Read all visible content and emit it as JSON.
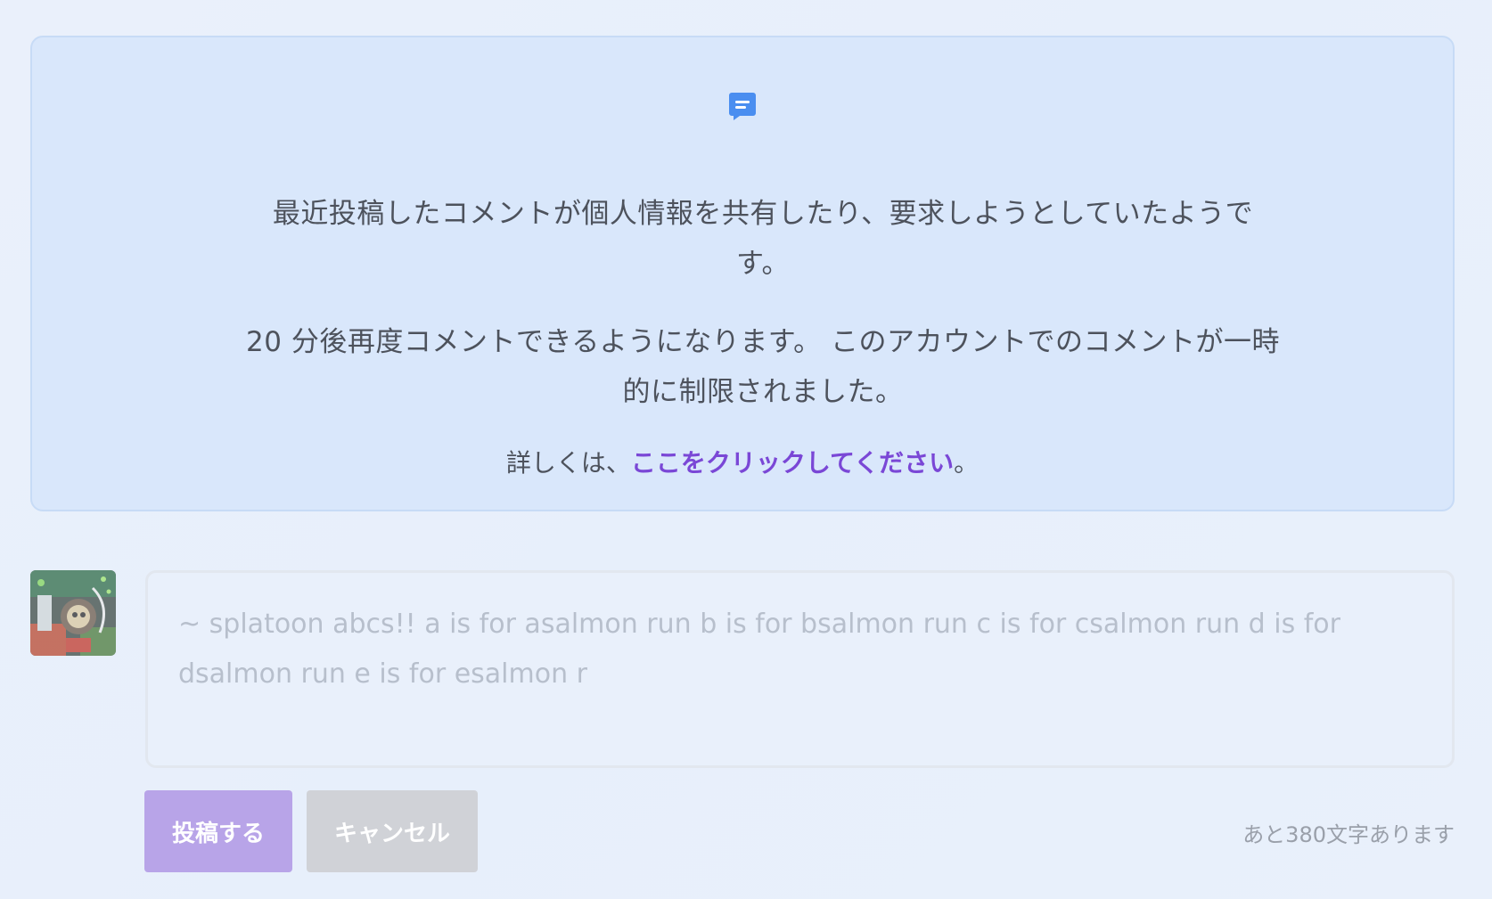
{
  "notice": {
    "icon": "comment-icon",
    "accent_color": "#4a8ef0",
    "message_1": "最近投稿したコメントが個人情報を共有したり、要求しようとしていたようです。",
    "message_2": "20 分後再度コメントできるようになります。 このアカウントでのコメントが一時的に制限されました。",
    "details_prefix": "詳しくは、",
    "details_link": "ここをクリックしてください",
    "details_suffix": "。"
  },
  "comment": {
    "avatar": "user-avatar",
    "text": "~ splatoon abcs!! a is for asalmon run b is for bsalmon run c is for csalmon run d is for dsalmon run e is for esalmon r",
    "post_label": "投稿する",
    "cancel_label": "キャンセル",
    "remaining": "あと380文字あります"
  }
}
